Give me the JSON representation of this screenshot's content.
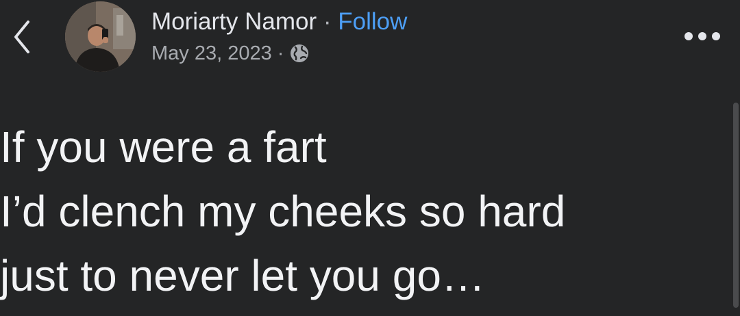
{
  "header": {
    "back_icon": "chevron-left-icon",
    "author_name": "Moriarty Namor",
    "name_separator": "·",
    "follow_label": "Follow",
    "date": "May 23, 2023",
    "meta_separator": "·",
    "privacy_icon": "globe-icon",
    "more_icon": "more-horizontal-icon"
  },
  "post": {
    "lines": [
      "If you were a fart",
      "I’d clench my cheeks so hard",
      "just to never let you go…"
    ]
  },
  "colors": {
    "background": "#242526",
    "link": "#4d9ff6",
    "text": "#f2f3f5",
    "meta": "#a8abb0"
  }
}
